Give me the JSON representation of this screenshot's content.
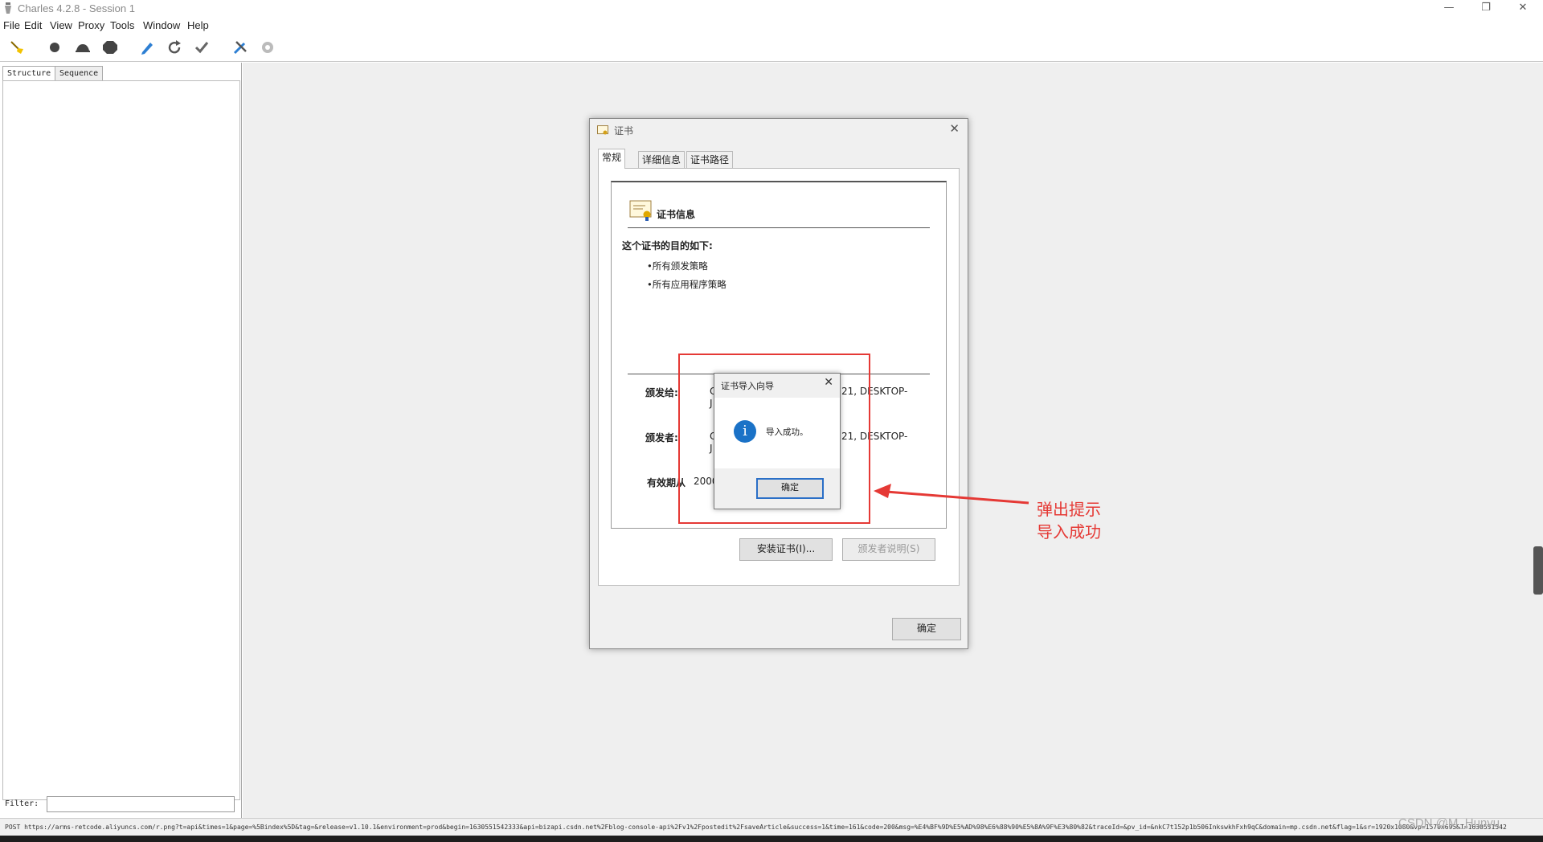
{
  "window": {
    "title": "Charles 4.2.8 - Session 1",
    "controls": {
      "minimize": "—",
      "restore": "❐",
      "close": "✕"
    }
  },
  "menu": [
    "File",
    "Edit",
    "View",
    "Proxy",
    "Tools",
    "Window",
    "Help"
  ],
  "toolbar": {
    "icons": [
      "broom-icon",
      "record-icon",
      "throttle-icon",
      "breakpoint-icon",
      "pen-icon",
      "refresh-icon",
      "check-icon",
      "tools-icon",
      "settings-gear-icon"
    ]
  },
  "sidebar": {
    "tabs": [
      "Structure",
      "Sequence"
    ],
    "filter_label": "Filter:",
    "filter_value": ""
  },
  "status_bar": {
    "text": "POST https://arms-retcode.aliyuncs.com/r.png?t=api&times=1&page=%5Bindex%5D&tag=&release=v1.10.1&environment=prod&begin=1630551542333&api=bizapi.csdn.net%2Fblog-console-api%2Fv1%2Fpostedit%2FsaveArticle&success=1&time=161&code=200&msg=%E4%BF%9D%E5%AD%98%E6%88%90%E5%8A%9F%E3%80%82&traceId=&pv_id=&nkC7t152p1b506InkswkhFxh9qC&domain=mp.csdn.net&flag=1&sr=1920x1080&vp=1570x695&T=1630551542"
  },
  "cert_dialog": {
    "title": "证书",
    "tabs": [
      "常规",
      "详细信息",
      "证书路径"
    ],
    "info_title": "证书信息",
    "purpose_title": "这个证书的目的如下:",
    "purposes": [
      "•所有颁发策略",
      "•所有应用程序策略"
    ],
    "issued_to_label": "颁发给:",
    "issued_to_value_a": "C",
    "issued_to_value_b": "21, DESKTOP-",
    "issued_to_value_c": "J",
    "issued_by_label": "颁发者:",
    "issued_by_value_a": "C",
    "issued_by_value_b": "21, DESKTOP-",
    "issued_by_value_c": "J",
    "validity_label": "有效期从",
    "validity_value": "2000",
    "install_button": "安装证书(I)...",
    "issuer_statement_button": "颁发者说明(S)",
    "ok_button": "确定"
  },
  "import_dialog": {
    "title": "证书导入向导",
    "message": "导入成功。",
    "ok_button": "确定",
    "close": "✕",
    "icon_glyph": "i"
  },
  "annotation": {
    "line1": "弹出提示",
    "line2": "导入成功",
    "color": "#e53935"
  },
  "watermark": "CSDN @M_Hunyu"
}
